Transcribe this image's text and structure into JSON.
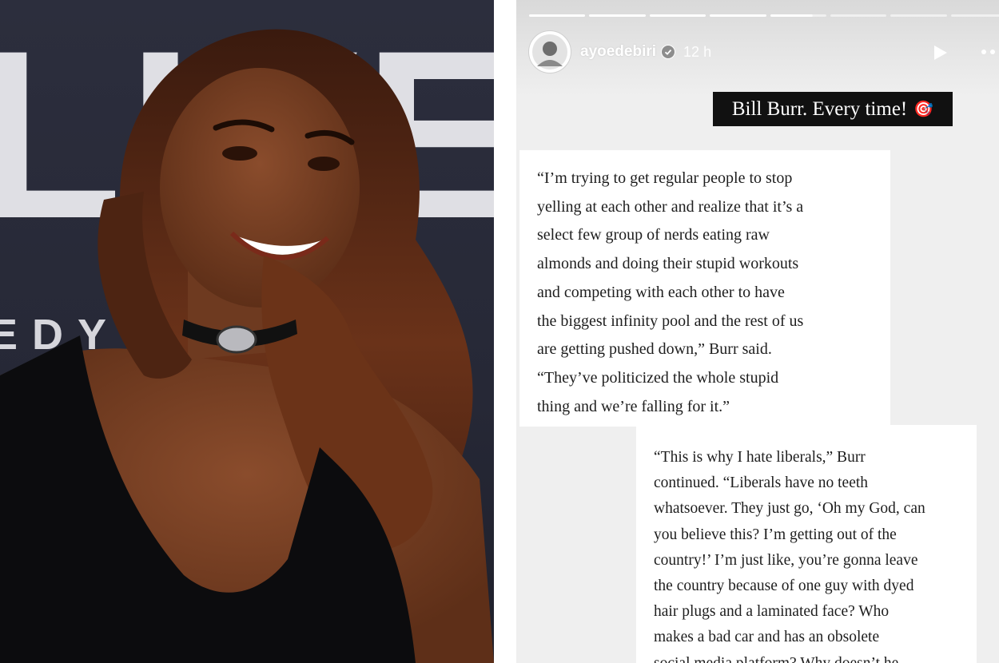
{
  "story": {
    "username": "ayoedebiri",
    "time_ago": "12 h",
    "progress": {
      "segments": 8,
      "completed": 4,
      "current_fraction": 0.75
    },
    "caption_text": "Bill Burr. Every time!",
    "caption_emoji": "🎯",
    "quote_1": "“I’m trying to get regular people to stop\nyelling at each other and realize that it’s a\nselect few group of nerds eating raw\nalmonds and doing their stupid workouts\nand competing with each other to have\nthe biggest infinity pool and the rest of us\nare getting pushed down,” Burr said.\n“They’ve politicized the whole stupid\nthing and we’re falling for it.”",
    "quote_2": "“This is why I hate liberals,” Burr\ncontinued. “Liberals have no teeth\nwhatsoever. They just go, ‘Oh my God, can\nyou believe this? I’m getting out of the\ncountry!’ I’m just like, you’re gonna leave\nthe country because of one guy with dyed\nhair plugs and a laminated face? Who\nmakes a bad car and has an obsolete\nsocial media platform? Why doesn’t he"
  },
  "photo": {
    "backdrop_letters_large": "LIVE",
    "backdrop_letters_small": "EDY S"
  },
  "colors": {
    "backdrop": "#2b2d3a",
    "caption_bg": "#111111",
    "story_bg": "#efefef",
    "hair": "#5a2a16",
    "dress": "#0c0c0e"
  }
}
